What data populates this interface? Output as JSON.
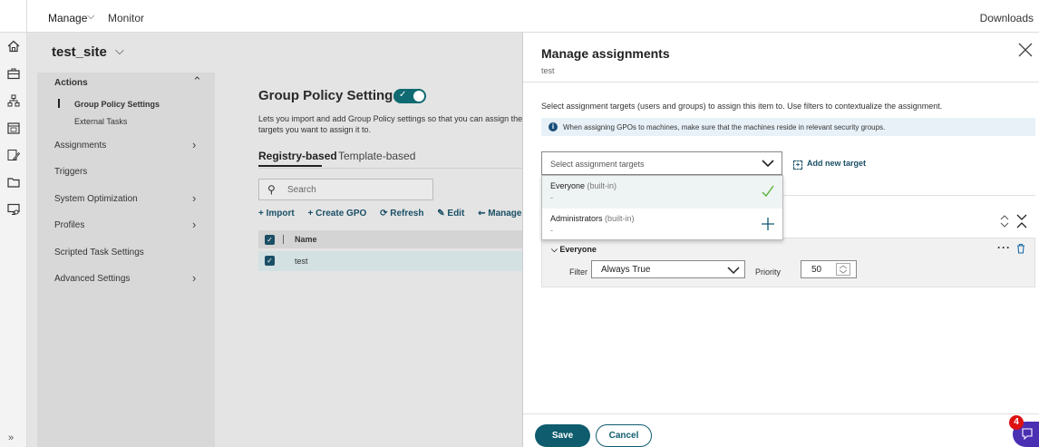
{
  "topbar": {
    "manage": "Manage",
    "monitor": "Monitor",
    "downloads": "Downloads"
  },
  "site": {
    "name": "test_site"
  },
  "rail_icons": [
    "home-icon",
    "briefcase-icon",
    "org-icon",
    "calendar-icon",
    "edit-icon",
    "folder-icon",
    "monitor-settings-icon"
  ],
  "leftnav": {
    "items": [
      {
        "label": "Actions",
        "bold": true,
        "arrow": "up"
      },
      {
        "label": "Group Policy Settings",
        "bold": true,
        "sub": true,
        "active": true
      },
      {
        "label": "External Tasks",
        "sub": true
      },
      {
        "label": "Assignments",
        "arrow": "right"
      },
      {
        "label": "Triggers"
      },
      {
        "label": "System Optimization",
        "arrow": "right"
      },
      {
        "label": "Profiles",
        "arrow": "right"
      },
      {
        "label": "Scripted Task Settings"
      },
      {
        "label": "Advanced Settings",
        "arrow": "right"
      }
    ]
  },
  "content": {
    "title": "Group Policy Settings",
    "description_line1": "Lets you import and add Group Policy settings so that you can assign them",
    "description_line2": "targets you want to assign it to.",
    "tabs": [
      "Registry-based",
      "Template-based"
    ],
    "search_placeholder": "Search",
    "toolbar": [
      "+ Import",
      "+ Create GPO",
      "⟳ Refresh",
      "✎ Edit",
      "⇜ Manage a"
    ],
    "table_header": "Name",
    "rows": [
      "test"
    ]
  },
  "panel": {
    "title": "Manage assignments",
    "subtitle": "test",
    "intro": "Select assignment targets (users and groups) to assign this item to. Use filters to contextualize the assignment.",
    "info": "When assigning GPOs to machines, make sure that the machines reside in relevant security groups.",
    "select_placeholder": "Select assignment targets",
    "add_new_target": "Add new target",
    "dropdown": [
      {
        "name": "Everyone",
        "suffix": "(built-in)",
        "detail": "-",
        "selected": true
      },
      {
        "name": "Administrators",
        "suffix": "(built-in)",
        "detail": "-",
        "selected": false
      }
    ],
    "assignment": {
      "name": "Everyone",
      "filter_label": "Filter",
      "filter_value": "Always True",
      "priority_label": "Priority",
      "priority_value": "50"
    },
    "save": "Save",
    "cancel": "Cancel"
  },
  "notification_count": "4",
  "colors": {
    "accent": "#0f5c6e",
    "check": "#5bb33a",
    "badge": "#4b2fb3"
  }
}
